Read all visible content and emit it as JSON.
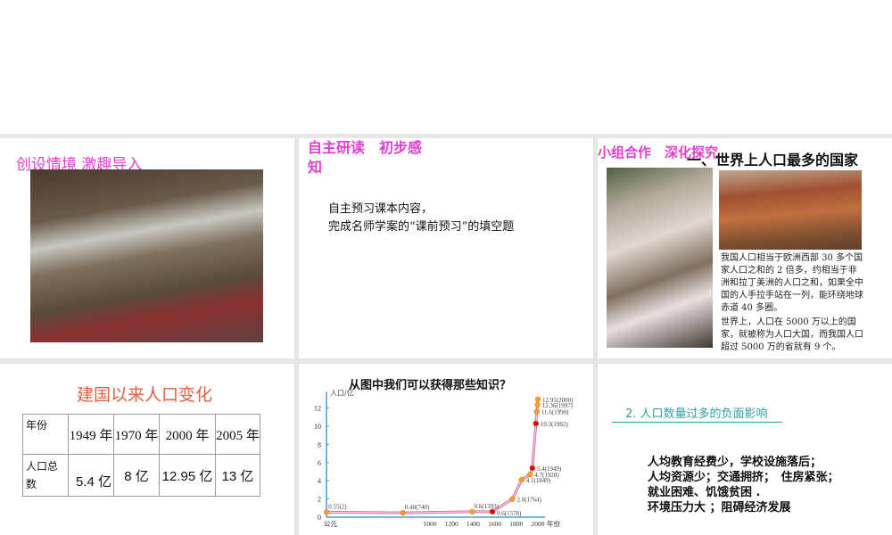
{
  "slide1": {
    "title": "创设情境 激趣导入"
  },
  "slide2": {
    "title_line1": "自主研读　初步感",
    "title_line2": "知",
    "body_line1": "自主预习课本内容，",
    "body_line2": "完成名师学案的“课前预习”的填空题"
  },
  "slide3": {
    "tag": "小组合作　深化探究",
    "title": "一、世界上人口最多的国家",
    "para1": "我国人口相当于欧洲西部 30 多个国家人口之和的 2 倍多，约相当于非洲和拉丁美洲的人口之和，如果全中国的人手拉手站在一列，能环绕地球赤道 40 多圈。",
    "para2": "世界上，人口在 5000 万以上的国家，就被称为人口大国，而我国人口超过 5000 万的省就有 9 个。"
  },
  "slide4": {
    "title": "建国以来人口变化",
    "row1_header": "年份",
    "row2_header": "人口总数",
    "years": [
      "1949 年",
      "1970 年",
      "2000 年",
      "2005 年"
    ],
    "values": [
      "5.4 亿",
      "8 亿",
      "12.95 亿",
      "13 亿"
    ]
  },
  "slide5": {
    "title": "从图中我们可以获得那些知识？"
  },
  "chart_data": {
    "type": "line",
    "title": "从图中我们可以获得那些知识？",
    "ylabel": "人口/亿",
    "xlabel": "年份",
    "ylim": [
      0,
      13
    ],
    "yticks": [
      "0",
      "2",
      "4",
      "6",
      "8",
      "10",
      "12"
    ],
    "xticks": [
      "公元",
      "1000",
      "1200",
      "1400",
      "1600",
      "1800",
      "2000"
    ],
    "xtick_values": [
      0,
      1000,
      1200,
      1400,
      1600,
      1800,
      2000
    ],
    "points": [
      {
        "year": 2,
        "value": 0.55,
        "label": "0.55(2)"
      },
      {
        "year": 740,
        "value": 0.48,
        "label": "0.48(740)"
      },
      {
        "year": 1393,
        "value": 0.6,
        "label": "0.6(1393)"
      },
      {
        "year": 1578,
        "value": 0.6,
        "label": "0.6(1578)",
        "highlight": true
      },
      {
        "year": 1764,
        "value": 2.0,
        "label": "2.0(1764)"
      },
      {
        "year": 1849,
        "value": 4.1,
        "label": "4.1(1849)"
      },
      {
        "year": 1928,
        "value": 4.7,
        "label": "4.7(1928)"
      },
      {
        "year": 1949,
        "value": 5.4,
        "label": "5.4(1949)",
        "highlight": true
      },
      {
        "year": 1982,
        "value": 10.3,
        "label": "10.3(1982)",
        "highlight": true
      },
      {
        "year": 1990,
        "value": 11.6,
        "label": "11.6(1990)"
      },
      {
        "year": 1997,
        "value": 12.36,
        "label": "12.36(1997)"
      },
      {
        "year": 2000,
        "value": 12.95,
        "label": "12.95(2000)"
      }
    ],
    "colors": {
      "line": "#d070a0",
      "point": "#f0a030",
      "highlight": "#e00000",
      "axis": "#40a0d0"
    }
  },
  "slide6": {
    "heading": "2. 人口数量过多的负面影响",
    "lines": [
      "人均教育经费少，学校设施落后；",
      "人均资源少；交通拥挤；　住房紧张；",
      "就业困难、饥饿贫困 .",
      "环境压力大 ；阻碍经济发展"
    ]
  }
}
